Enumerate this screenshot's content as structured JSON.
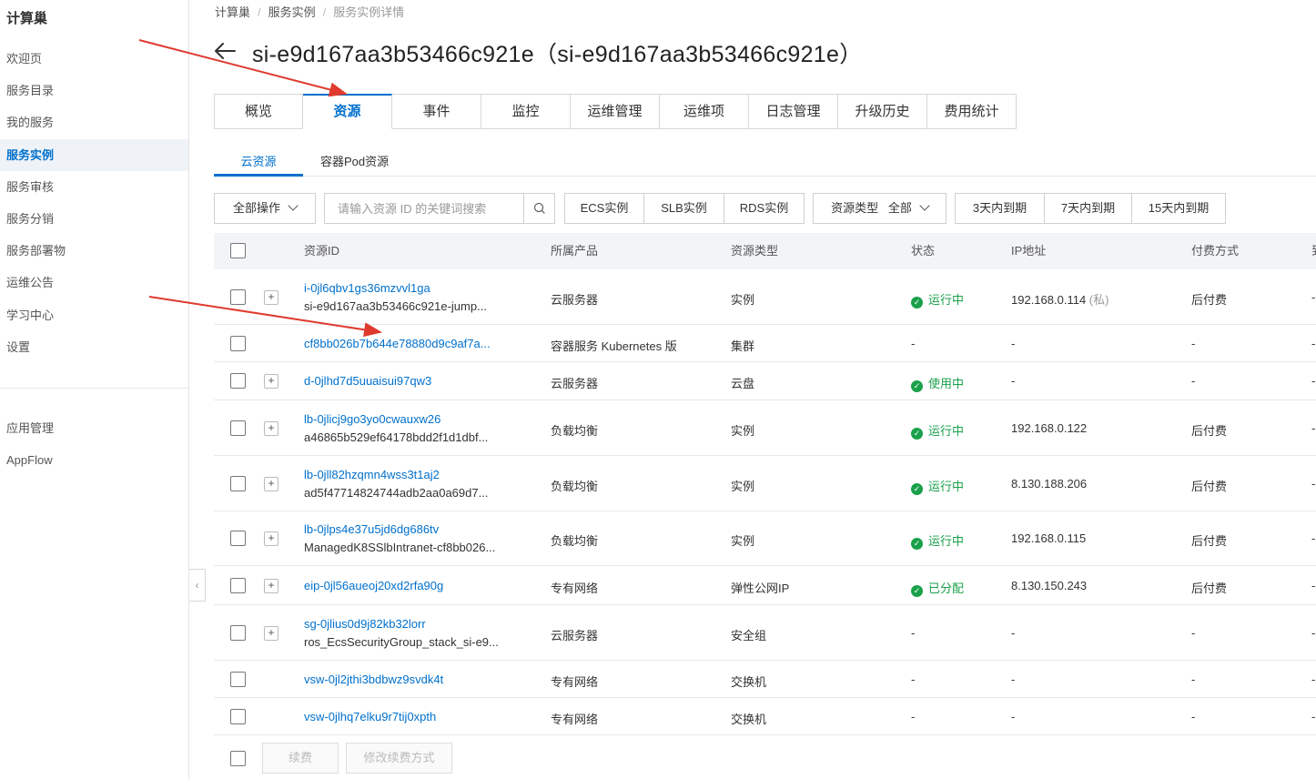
{
  "sidebar": {
    "title": "计算巢",
    "items": [
      {
        "label": "欢迎页"
      },
      {
        "label": "服务目录"
      },
      {
        "label": "我的服务"
      },
      {
        "label": "服务实例"
      },
      {
        "label": "服务审核"
      },
      {
        "label": "服务分销"
      },
      {
        "label": "服务部署物"
      },
      {
        "label": "运维公告"
      },
      {
        "label": "学习中心"
      },
      {
        "label": "设置"
      }
    ],
    "bottom_items": [
      {
        "label": "应用管理"
      },
      {
        "label": "AppFlow"
      }
    ],
    "active_item": "服务实例",
    "collapse_symbol": "‹"
  },
  "breadcrumb": [
    "计算巢",
    "服务实例",
    "服务实例详情"
  ],
  "page_title": "si-e9d167aa3b53466c921e（si-e9d167aa3b53466c921e）",
  "tabs": [
    "概览",
    "资源",
    "事件",
    "监控",
    "运维管理",
    "运维项",
    "日志管理",
    "升级历史",
    "费用统计"
  ],
  "active_tab": "资源",
  "subtabs": [
    "云资源",
    "容器Pod资源"
  ],
  "active_subtab": "云资源",
  "toolbar": {
    "bulk_action": "全部操作",
    "search_placeholder": "请输入资源 ID 的关键词搜索",
    "type_filters": [
      "ECS实例",
      "SLB实例",
      "RDS实例"
    ],
    "resource_type_label": "资源类型",
    "resource_type_value": "全部",
    "expiry_filters": [
      "3天内到期",
      "7天内到期",
      "15天内到期"
    ]
  },
  "table": {
    "headers": [
      "资源ID",
      "所属产品",
      "资源类型",
      "状态",
      "IP地址",
      "付费方式",
      "到"
    ],
    "rows": [
      {
        "id": "i-0jl6qbv1gs36mzvvl1ga",
        "name": "si-e9d167aa3b53466c921e-jump...",
        "product": "云服务器",
        "type": "实例",
        "status": "运行中",
        "ip": "192.168.0.114",
        "ip_note": "(私)",
        "pay": "后付费",
        "last": "-",
        "expandable": true
      },
      {
        "id": "cf8bb026b7b644e78880d9c9af7a...",
        "name": "",
        "product": "容器服务 Kubernetes 版",
        "type": "集群",
        "status": "-",
        "ip": "-",
        "ip_note": "",
        "pay": "-",
        "last": "-",
        "expandable": false
      },
      {
        "id": "d-0jlhd7d5uuaisui97qw3",
        "name": "",
        "product": "云服务器",
        "type": "云盘",
        "status": "使用中",
        "ip": "-",
        "ip_note": "",
        "pay": "-",
        "last": "-",
        "expandable": true
      },
      {
        "id": "lb-0jlicj9go3yo0cwauxw26",
        "name": "a46865b529ef64178bdd2f1d1dbf...",
        "product": "负载均衡",
        "type": "实例",
        "status": "运行中",
        "ip": "192.168.0.122",
        "ip_note": "",
        "pay": "后付费",
        "last": "-",
        "expandable": true
      },
      {
        "id": "lb-0jll82hzqmn4wss3t1aj2",
        "name": "ad5f47714824744adb2aa0a69d7...",
        "product": "负载均衡",
        "type": "实例",
        "status": "运行中",
        "ip": "8.130.188.206",
        "ip_note": "",
        "pay": "后付费",
        "last": "-",
        "expandable": true
      },
      {
        "id": "lb-0jlps4e37u5jd6dg686tv",
        "name": "ManagedK8SSlbIntranet-cf8bb026...",
        "product": "负载均衡",
        "type": "实例",
        "status": "运行中",
        "ip": "192.168.0.115",
        "ip_note": "",
        "pay": "后付费",
        "last": "-",
        "expandable": true
      },
      {
        "id": "eip-0jl56aueoj20xd2rfa90g",
        "name": "",
        "product": "专有网络",
        "type": "弹性公网IP",
        "status": "已分配",
        "ip": "8.130.150.243",
        "ip_note": "",
        "pay": "后付费",
        "last": "-",
        "expandable": true
      },
      {
        "id": "sg-0jlius0d9j82kb32lorr",
        "name": "ros_EcsSecurityGroup_stack_si-e9...",
        "product": "云服务器",
        "type": "安全组",
        "status": "-",
        "ip": "-",
        "ip_note": "",
        "pay": "-",
        "last": "-",
        "expandable": true
      },
      {
        "id": "vsw-0jl2jthi3bdbwz9svdk4t",
        "name": "",
        "product": "专有网络",
        "type": "交换机",
        "status": "-",
        "ip": "-",
        "ip_note": "",
        "pay": "-",
        "last": "-",
        "expandable": false
      },
      {
        "id": "vsw-0jlhq7elku9r7tij0xpth",
        "name": "",
        "product": "专有网络",
        "type": "交换机",
        "status": "-",
        "ip": "-",
        "ip_note": "",
        "pay": "-",
        "last": "-",
        "expandable": false
      }
    ]
  },
  "footer": {
    "renew": "续费",
    "change_billing": "修改续费方式"
  },
  "colors": {
    "accent": "#0070cc",
    "status_ok": "#1aa04b",
    "annotation_arrow": "#e03a2f"
  }
}
